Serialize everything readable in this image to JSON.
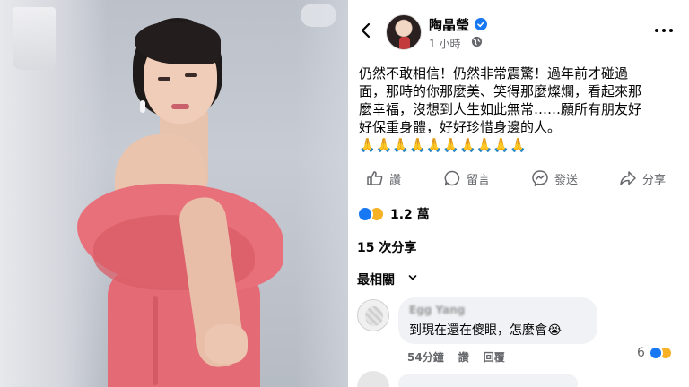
{
  "post": {
    "author": "陶晶瑩",
    "time": "1 小時",
    "text_lines": [
      "仍然不敢相信！仍然非常震驚！過年前才碰過",
      "面，那時的你那麼美、笑得那麼燦爛，看起來那",
      "麼幸福，沒想到人生如此無常……願所有朋友好",
      "好保重身體，好好珍惜身邊的人。",
      "🙏🙏🙏🙏🙏🙏🙏🙏🙏🙏"
    ]
  },
  "actions": {
    "like": "讚",
    "comment": "留言",
    "send": "發送",
    "share": "分享"
  },
  "reactions": {
    "count": "1.2 萬"
  },
  "shares": "15 次分享",
  "sort": "最相關",
  "comment": {
    "author": "Egg Yang",
    "text": "到現在還在傻眼，怎麼會😭",
    "time": "54分鐘",
    "like": "讚",
    "reply": "回覆",
    "reactions": "6"
  },
  "colors": {
    "brand": "#1877f2",
    "sad": "#f7b125",
    "muted": "#65676b",
    "bubble": "#f0f2f5"
  }
}
